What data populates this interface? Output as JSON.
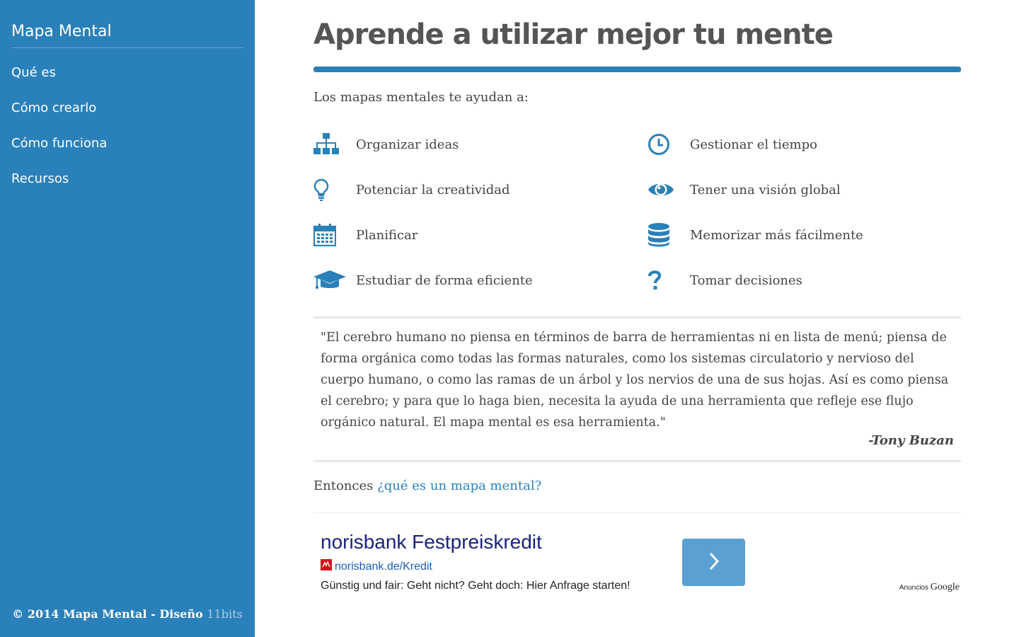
{
  "sidebar": {
    "brand": "Mapa Mental",
    "nav": [
      "Qué es",
      "Cómo crearlo",
      "Cómo funciona",
      "Recursos"
    ],
    "footer_prefix": "© 2014 Mapa Mental - Diseño",
    "footer_credit": "11bits"
  },
  "main": {
    "title": "Aprende a utilizar mejor tu mente",
    "intro": "Los mapas mentales te ayudan a:",
    "benefits_left": [
      {
        "icon": "sitemap-icon",
        "label": "Organizar ideas"
      },
      {
        "icon": "lightbulb-icon",
        "label": "Potenciar la creatividad"
      },
      {
        "icon": "calendar-icon",
        "label": "Planificar"
      },
      {
        "icon": "graduation-cap-icon",
        "label": "Estudiar de forma eficiente"
      }
    ],
    "benefits_right": [
      {
        "icon": "clock-icon",
        "label": "Gestionar el tiempo"
      },
      {
        "icon": "eye-icon",
        "label": "Tener una visión global"
      },
      {
        "icon": "database-icon",
        "label": "Memorizar más fácilmente"
      },
      {
        "icon": "question-icon",
        "label": "Tomar decisiones"
      }
    ],
    "quote": "\"El cerebro humano no piensa en términos de barra de herramientas ni en lista de menú; piensa de forma orgánica como todas las formas naturales, como los sistemas circulatorio y nervioso del cuerpo humano, o como las ramas de un árbol y los nervios de una de sus hojas. Así es como piensa el cerebro; y para que lo haga bien, necesita la ayuda de una herramienta que refleje ese flujo orgánico natural. El mapa mental es esa herramienta.\"",
    "quote_author": "-Tony Buzan",
    "then_text": "Entonces",
    "then_link": "¿qué es un mapa mental?"
  },
  "ad": {
    "title": "norisbank Festpreiskredit",
    "url": "norisbank.de/Kredit",
    "description": "Günstig und fair: Geht nicht? Geht doch: Hier Anfrage starten!",
    "badge_label": "Anuncios",
    "badge_brand": "Google"
  },
  "colors": {
    "accent": "#2a80b9",
    "ad_button": "#5aa0d3",
    "ad_title": "#1a237e"
  }
}
